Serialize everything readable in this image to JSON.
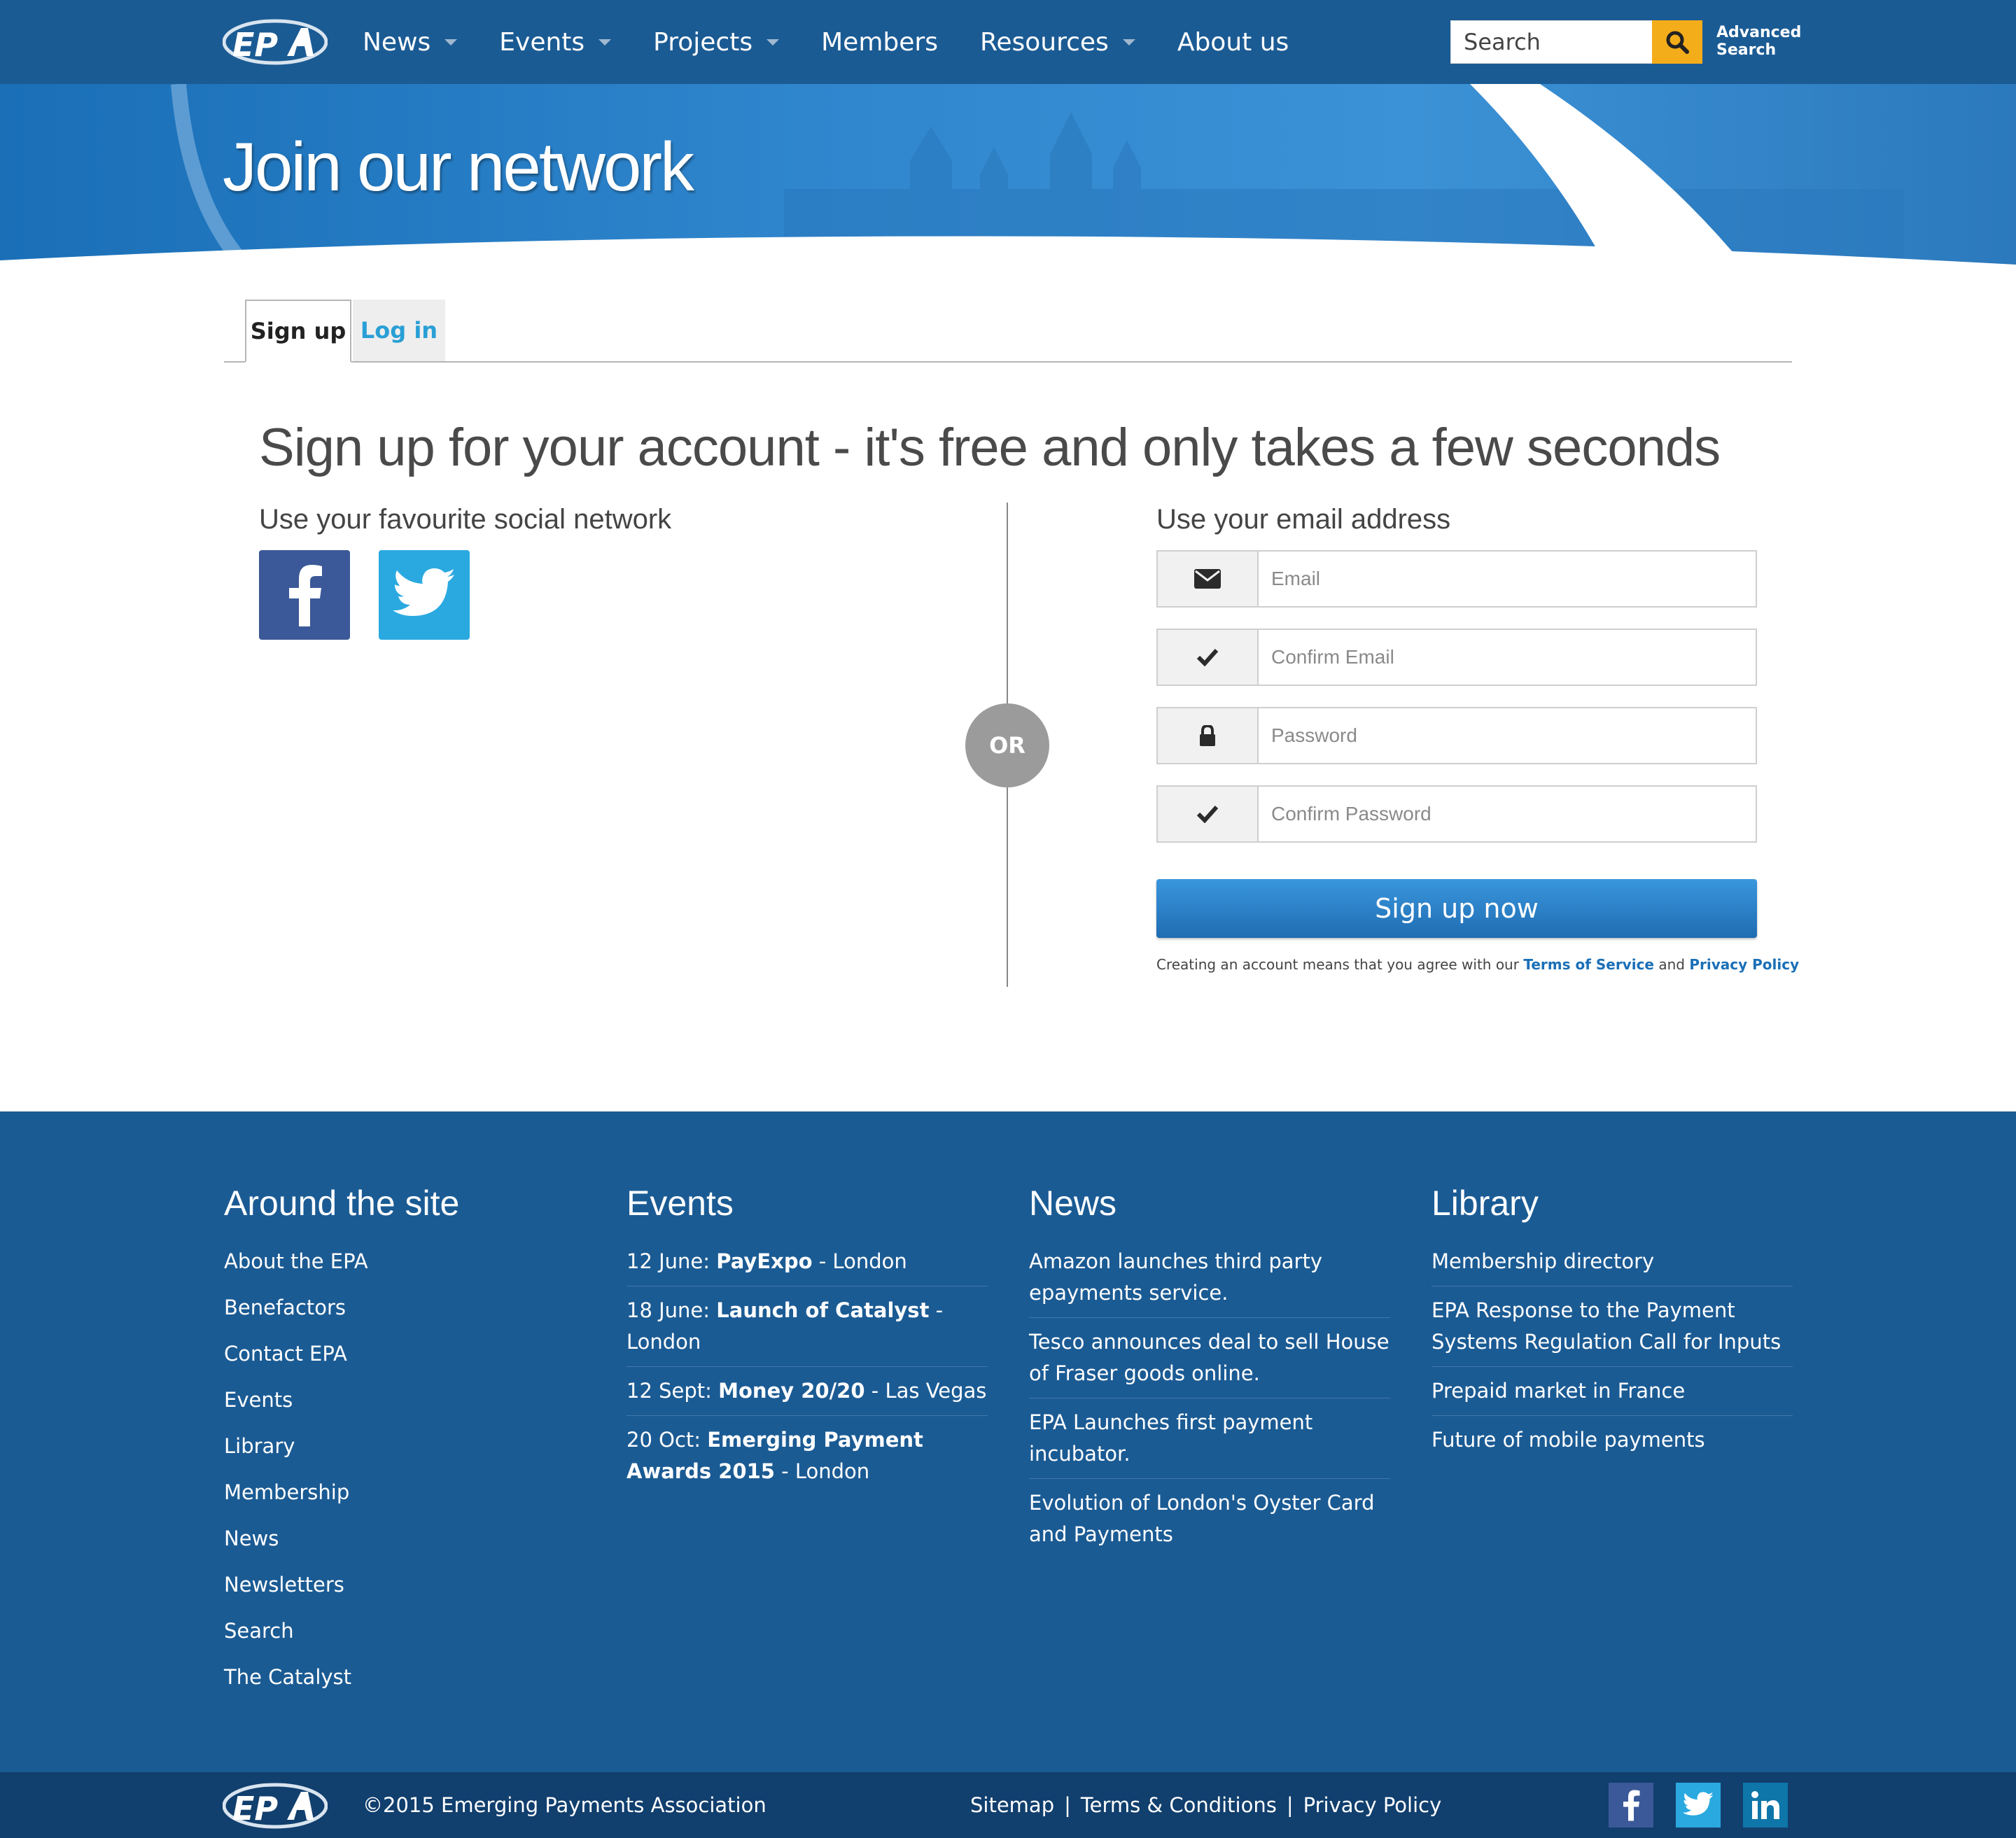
{
  "header": {
    "logo_text": "EPA",
    "nav": [
      {
        "label": "News",
        "has_caret": true
      },
      {
        "label": "Events",
        "has_caret": true
      },
      {
        "label": "Projects",
        "has_caret": true
      },
      {
        "label": "Members",
        "has_caret": false
      },
      {
        "label": "Resources",
        "has_caret": true
      },
      {
        "label": "About us",
        "has_caret": false
      }
    ],
    "search_placeholder": "Search",
    "advanced_search_line1": "Advanced",
    "advanced_search_line2": "Search"
  },
  "hero": {
    "title": "Join our network"
  },
  "tabs": {
    "signup": "Sign up",
    "login": "Log in"
  },
  "signup": {
    "headline": "Sign up for your account - it's free and only takes a few seconds",
    "social_heading": "Use your favourite social network",
    "or_label": "OR",
    "email_heading": "Use your email address",
    "fields": {
      "email": "Email",
      "confirm_email": "Confirm Email",
      "password": "Password",
      "confirm_password": "Confirm Password"
    },
    "submit": "Sign up now",
    "terms_prefix": "Creating an account means that you agree with our",
    "terms_link": "Terms of Service",
    "terms_and": "and",
    "privacy_link": "Privacy Policy"
  },
  "footer": {
    "around": {
      "title": "Around the site",
      "items": [
        "About the EPA",
        "Benefactors",
        "Contact EPA",
        "Events",
        "Library",
        "Membership",
        "News",
        "Newsletters",
        "Search",
        "The Catalyst"
      ]
    },
    "events": {
      "title": "Events",
      "items": [
        {
          "date": "12 June: ",
          "name": "PayExpo",
          "place": " - London"
        },
        {
          "date": "18 June: ",
          "name": "Launch of Catalyst",
          "place": " - London"
        },
        {
          "date": "12 Sept: ",
          "name": "Money 20/20",
          "place": " - Las Vegas"
        },
        {
          "date": "20 Oct: ",
          "name": "Emerging Payment Awards 2015",
          "place": " - London"
        }
      ]
    },
    "news": {
      "title": "News",
      "items": [
        "Amazon launches third party epayments service.",
        "Tesco announces deal to sell House of Fraser goods online.",
        "EPA Launches first payment incubator.",
        "Evolution of London's Oyster Card and Payments"
      ]
    },
    "library": {
      "title": "Library",
      "items": [
        "Membership directory",
        "EPA Response to the Payment Systems Regulation Call for Inputs",
        "Prepaid market in France",
        "Future of mobile payments"
      ]
    }
  },
  "bottom": {
    "copyright": "©2015 Emerging Payments Association",
    "links": [
      "Sitemap",
      "Terms & Conditions",
      "Privacy Policy"
    ],
    "separator": "|"
  },
  "colors": {
    "brand_blue": "#1b5b94",
    "dark_blue": "#113f6e",
    "accent_yellow": "#f4ad1a",
    "facebook": "#3b5998",
    "twitter": "#2aa9e0",
    "linkedin": "#0e76a8"
  }
}
